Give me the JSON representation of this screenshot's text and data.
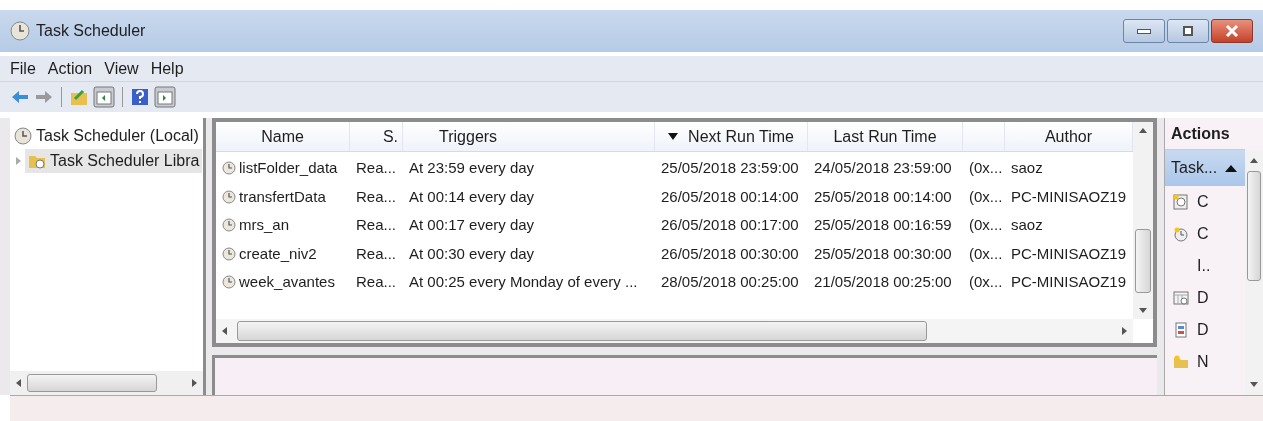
{
  "window": {
    "title": "Task Scheduler"
  },
  "menu": [
    "File",
    "Action",
    "View",
    "Help"
  ],
  "tree": {
    "label": "Task Scheduler (Local)",
    "children": [
      {
        "label": "Task Scheduler Libra",
        "expanded": false,
        "selected": true
      }
    ]
  },
  "table": {
    "columns": [
      {
        "label": "Name",
        "sorted": false
      },
      {
        "label": "S.",
        "sorted": false
      },
      {
        "label": "Triggers",
        "sorted": false
      },
      {
        "label": "Next Run Time",
        "sorted": true
      },
      {
        "label": "Last Run Time",
        "sorted": false
      },
      {
        "sorted": false
      },
      {
        "label": "Author",
        "sorted": false
      }
    ],
    "rows": [
      {
        "name": "listFolder_data",
        "status": "Rea...",
        "triggers": "At 23:59 every day",
        "next_run": "25/05/2018 23:59:00",
        "last_run": "24/05/2018 23:59:00",
        "result": "(0x...",
        "author": "saoz"
      },
      {
        "name": "transfertData",
        "status": "Rea...",
        "triggers": "At 00:14 every day",
        "next_run": "26/05/2018 00:14:00",
        "last_run": "25/05/2018 00:14:00",
        "result": "(0x...",
        "author": "PC-MINISAOZ19"
      },
      {
        "name": "mrs_an",
        "status": "Rea...",
        "triggers": "At 00:17 every day",
        "next_run": "26/05/2018 00:17:00",
        "last_run": "25/05/2018 00:16:59",
        "result": "(0x...",
        "author": "saoz"
      },
      {
        "name": "create_niv2",
        "status": "Rea...",
        "triggers": "At 00:30 every day",
        "next_run": "26/05/2018 00:30:00",
        "last_run": "25/05/2018 00:30:00",
        "result": "(0x...",
        "author": "PC-MINISAOZ19"
      },
      {
        "name": "week_avantes",
        "status": "Rea...",
        "triggers": "At 00:25 every Monday of every ...",
        "next_run": "28/05/2018 00:25:00",
        "last_run": "21/05/2018 00:25:00",
        "result": "(0x...",
        "author": "PC-MINISAOZ19"
      }
    ]
  },
  "actions": {
    "title": "Actions",
    "section": {
      "label": "Task...",
      "expanded": true
    },
    "items": [
      {
        "label": "C",
        "kind": "calendar"
      },
      {
        "label": "C",
        "kind": "clock"
      },
      {
        "label": "I..",
        "kind": "none"
      },
      {
        "label": "D",
        "kind": "grid"
      },
      {
        "label": "D",
        "kind": "sheet"
      },
      {
        "label": "N",
        "kind": "folder"
      }
    ]
  }
}
